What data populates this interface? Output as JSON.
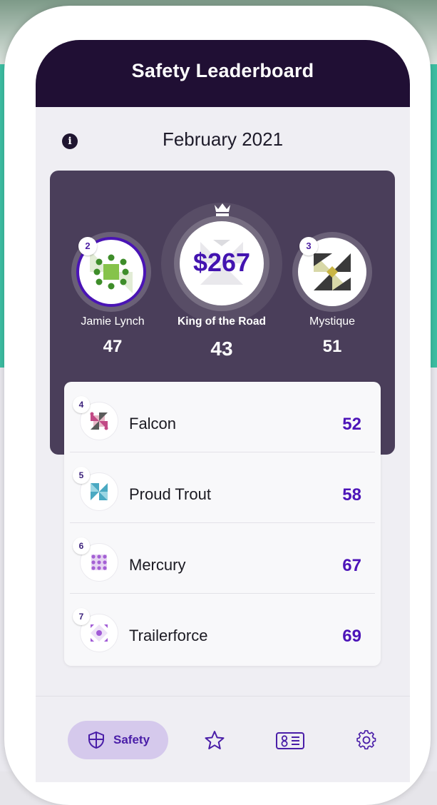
{
  "header": {
    "title": "Safety Leaderboard"
  },
  "month": "February 2021",
  "podium": {
    "first": {
      "rank": "1",
      "name": "King of the Road",
      "score": "43",
      "prize": "$267"
    },
    "second": {
      "rank": "2",
      "name": "Jamie Lynch",
      "score": "47"
    },
    "third": {
      "rank": "3",
      "name": "Mystique",
      "score": "51"
    }
  },
  "list": [
    {
      "rank": "4",
      "name": "Falcon",
      "score": "52"
    },
    {
      "rank": "5",
      "name": "Proud Trout",
      "score": "58"
    },
    {
      "rank": "6",
      "name": "Mercury",
      "score": "67"
    },
    {
      "rank": "7",
      "name": "Trailerforce",
      "score": "69"
    }
  ],
  "nav": {
    "safety_label": "Safety",
    "items": [
      "shield-icon",
      "star-icon",
      "id-card-icon",
      "gear-icon"
    ]
  },
  "colors": {
    "header": "#200f34",
    "podium": "#4a3e5a",
    "accent": "#4c14b8",
    "active_pill": "#d5c9ec",
    "teal": "#3dbfa3"
  }
}
